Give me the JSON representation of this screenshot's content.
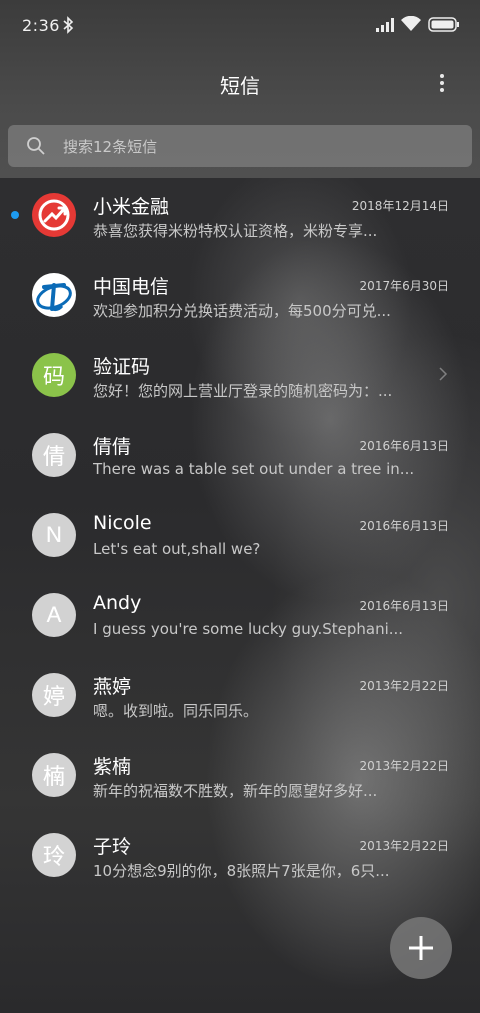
{
  "status_bar": {
    "time": "2:36"
  },
  "header": {
    "title": "短信"
  },
  "search": {
    "placeholder": "搜索12条短信"
  },
  "conversations": [
    {
      "name": "小米金融",
      "date": "2018年12月14日",
      "preview": "恭喜您获得米粉特权认证资格，米粉专享...",
      "avatar_type": "mi-finance-logo",
      "unread": true
    },
    {
      "name": "中国电信",
      "date": "2017年6月30日",
      "preview": "欢迎参加积分兑换话费活动，每500分可兑...",
      "avatar_type": "china-telecom-logo",
      "unread": false
    },
    {
      "name": "验证码",
      "date": "",
      "preview": "您好！您的网上营业厅登录的随机密码为：...",
      "avatar_type": "text",
      "avatar_text": "码",
      "avatar_color": "#8bc34a",
      "unread": false
    },
    {
      "name": "倩倩",
      "date": "2016年6月13日",
      "preview": "There was a table set out under a tree in...",
      "avatar_type": "text",
      "avatar_text": "倩",
      "unread": false
    },
    {
      "name": "Nicole",
      "date": "2016年6月13日",
      "preview": "Let's eat out,shall we?",
      "avatar_type": "text",
      "avatar_text": "N",
      "unread": false
    },
    {
      "name": "Andy",
      "date": "2016年6月13日",
      "preview": "I guess you're some lucky guy.Stephani...",
      "avatar_type": "text",
      "avatar_text": "A",
      "unread": false
    },
    {
      "name": "燕婷",
      "date": "2013年2月22日",
      "preview": "嗯。收到啦。同乐同乐。",
      "avatar_type": "text",
      "avatar_text": "婷",
      "unread": false
    },
    {
      "name": "紫楠",
      "date": "2013年2月22日",
      "preview": "新年的祝福数不胜数，新年的愿望好多好...",
      "avatar_type": "text",
      "avatar_text": "楠",
      "unread": false
    },
    {
      "name": "子玲",
      "date": "2013年2月22日",
      "preview": "10分想念9别的你，8张照片7张是你，6只...",
      "avatar_type": "text",
      "avatar_text": "玲",
      "unread": false
    }
  ],
  "colors": {
    "unread_dot": "#1e9bf0",
    "mi_finance": "#e53935",
    "china_telecom": "#0b6bb7",
    "verify_green": "#8bc34a"
  },
  "icons": [
    "bluetooth-icon",
    "signal-icon",
    "wifi-icon",
    "battery-icon",
    "more-icon",
    "search-icon",
    "chevron-right-icon",
    "plus-icon"
  ]
}
